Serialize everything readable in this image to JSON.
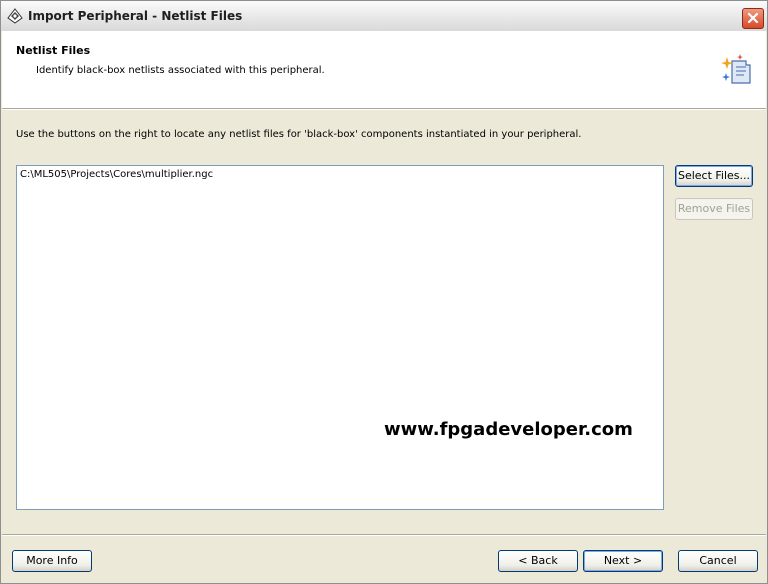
{
  "window": {
    "title": "Import Peripheral - Netlist Files"
  },
  "header": {
    "title": "Netlist Files",
    "subtitle": "Identify black-box netlists associated with this peripheral.",
    "icon": "wizard-sparkle-icon"
  },
  "main": {
    "instruction": "Use the buttons on the right to locate any netlist files for 'black-box' components instantiated in your peripheral.",
    "files": [
      "C:\\ML505\\Projects\\Cores\\multiplier.ngc"
    ],
    "watermark": "www.fpgadeveloper.com"
  },
  "side_buttons": {
    "select_files": "Select Files...",
    "remove_files": "Remove Files"
  },
  "footer": {
    "more_info": "More Info",
    "back": "< Back",
    "next": "Next >",
    "cancel": "Cancel"
  },
  "colors": {
    "dialog_bg": "#ece9d8",
    "list_border": "#7f9db9",
    "button_border": "#003c74",
    "close_button": "#d9492a"
  }
}
